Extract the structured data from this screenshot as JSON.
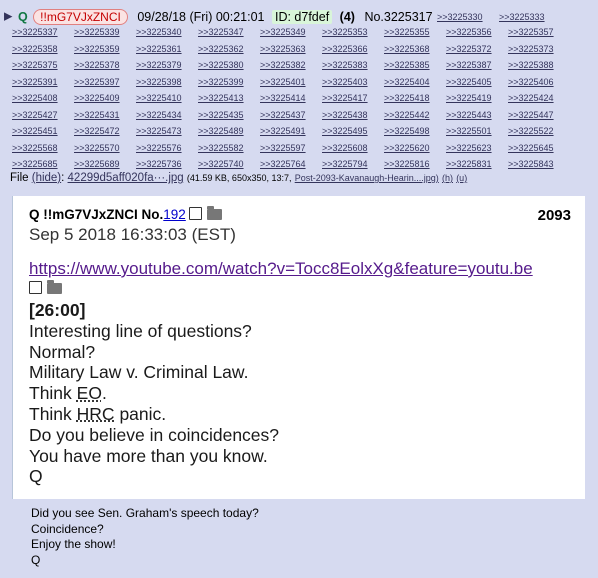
{
  "header": {
    "arrow": "▶",
    "name": "Q",
    "tripcode": "!!mG7VJxZNCI",
    "datetime": "09/28/18 (Fri) 00:21:01",
    "id_label": "ID: d7fdef",
    "post_count": "(4)",
    "post_number": "No.3225317"
  },
  "backlinks": [
    ">>3225330",
    ">>3225333",
    ">>3225337",
    ">>3225339",
    ">>3225340",
    ">>3225347",
    ">>3225349",
    ">>3225353",
    ">>3225355",
    ">>3225356",
    ">>3225357",
    ">>3225358",
    ">>3225359",
    ">>3225361",
    ">>3225362",
    ">>3225363",
    ">>3225366",
    ">>3225368",
    ">>3225372",
    ">>3225373",
    ">>3225375",
    ">>3225378",
    ">>3225379",
    ">>3225380",
    ">>3225382",
    ">>3225383",
    ">>3225385",
    ">>3225387",
    ">>3225388",
    ">>3225391",
    ">>3225397",
    ">>3225398",
    ">>3225399",
    ">>3225401",
    ">>3225403",
    ">>3225404",
    ">>3225405",
    ">>3225406",
    ">>3225408",
    ">>3225409",
    ">>3225410",
    ">>3225413",
    ">>3225414",
    ">>3225417",
    ">>3225418",
    ">>3225419",
    ">>3225424",
    ">>3225427",
    ">>3225431",
    ">>3225434",
    ">>3225435",
    ">>3225437",
    ">>3225438",
    ">>3225442",
    ">>3225443",
    ">>3225447",
    ">>3225451",
    ">>3225472",
    ">>3225473",
    ">>3225489",
    ">>3225491",
    ">>3225495",
    ">>3225498",
    ">>3225501",
    ">>3225522",
    ">>3225568",
    ">>3225570",
    ">>3225576",
    ">>3225582",
    ">>3225597",
    ">>3225608",
    ">>3225620",
    ">>3225623",
    ">>3225645",
    ">>3225685",
    ">>3225689",
    ">>3225736",
    ">>3225740",
    ">>3225764",
    ">>3225794",
    ">>3225816",
    ">>3225831",
    ">>3225843"
  ],
  "file": {
    "label": "File",
    "hide": "(hide)",
    "filename": "42299d5aff020fa···.jpg",
    "meta": "(41.59 KB, 650x350, 13:7,",
    "original": "Post-2093-Kavanaugh-Hearin....jpg)",
    "h": "(h)",
    "u": "(u)"
  },
  "image": {
    "q_name": "Q !!mG7VJxZNCI No.",
    "q_no": "192",
    "drop_number": "2093",
    "date": "Sep 5 2018 16:33:03 (EST)",
    "url": "https://www.youtube.com/watch?v=Tocc8EolxXg&feature=youtu.be",
    "timestamp": "[26:00]",
    "lines": [
      "Interesting line of questions?",
      "Normal?",
      "Military Law v. Criminal Law.",
      "Think ",
      "EO",
      ".",
      "Think ",
      "HRC",
      " panic.",
      "Do you believe in coincidences?",
      "You have more than you know.",
      "Q"
    ]
  },
  "message": {
    "lines": [
      "Did you see Sen. Graham's speech today?",
      "Coincidence?",
      "Enjoy the show!",
      "Q"
    ]
  },
  "colors": {
    "post_bg": "#d6daf0",
    "name": "#117743",
    "trip": "#c40000",
    "link": "#34345c"
  }
}
